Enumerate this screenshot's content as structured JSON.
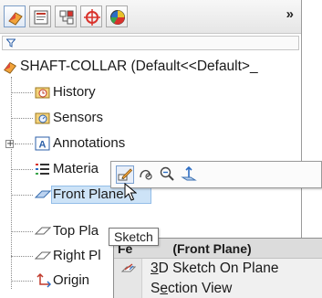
{
  "manager_tabs": {
    "items": [
      {
        "icon": "feature-manager-icon"
      },
      {
        "icon": "property-manager-icon"
      },
      {
        "icon": "configuration-manager-icon"
      },
      {
        "icon": "dimxpert-manager-icon"
      },
      {
        "icon": "display-manager-icon"
      }
    ],
    "more_label": "»"
  },
  "filter": {
    "icon": "filter-icon"
  },
  "tree": {
    "root_label": "SHAFT-COLLAR  (Default<<Default>_",
    "items": [
      {
        "label": "History",
        "icon": "history-folder-icon",
        "expander": ""
      },
      {
        "label": "Sensors",
        "icon": "sensors-folder-icon",
        "expander": ""
      },
      {
        "label": "Annotations",
        "icon": "annotations-icon",
        "expander": "+"
      },
      {
        "label": "Materia",
        "icon": "material-icon",
        "expander": ""
      },
      {
        "label": "Front Plane",
        "icon": "plane-icon",
        "expander": "",
        "selected": true
      },
      {
        "label": "Top Pla",
        "icon": "plane-icon",
        "expander": ""
      },
      {
        "label": "Right Pl",
        "icon": "plane-icon",
        "expander": ""
      },
      {
        "label": "Origin",
        "icon": "origin-icon",
        "expander": ""
      }
    ]
  },
  "context_toolbar": {
    "buttons": [
      {
        "icon": "sketch-icon",
        "hovered": true
      },
      {
        "icon": "view-orientation-icon"
      },
      {
        "icon": "zoom-to-selection-icon"
      },
      {
        "icon": "normal-to-icon"
      }
    ]
  },
  "tooltip": {
    "text": "Sketch"
  },
  "context_menu": {
    "header_prefix": "Fe",
    "header_rest": "(Front Plane)",
    "items": [
      {
        "before": "",
        "underlined": "3",
        "after": "D Sketch On Plane",
        "icon": "3d-sketch-on-plane-icon"
      },
      {
        "before": "S",
        "underlined": "e",
        "after": "ction View",
        "icon": ""
      }
    ]
  },
  "colors": {
    "selection": "#cde3f7",
    "tab_red": "#d9322b",
    "tab_blue": "#2b6cc4"
  }
}
